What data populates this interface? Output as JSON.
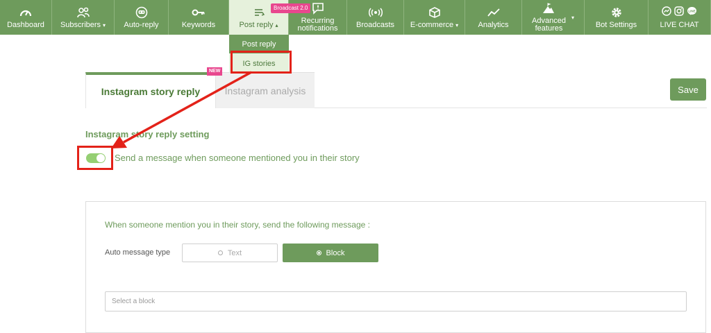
{
  "nav": {
    "items": [
      {
        "label": "Dashboard",
        "icon": "gauge-icon"
      },
      {
        "label": "Subscribers",
        "icon": "users-icon",
        "caret": "▾"
      },
      {
        "label": "Auto-reply",
        "icon": "robot-icon"
      },
      {
        "label": "Keywords",
        "icon": "key-icon"
      },
      {
        "label": "Post reply",
        "icon": "reply-icon",
        "caret": "▴",
        "active": true
      },
      {
        "label": "Recurring notifications",
        "icon": "message-alert-icon",
        "badge": "Broadcast 2.0"
      },
      {
        "label": "Broadcasts",
        "icon": "broadcast-icon"
      },
      {
        "label": "E-commerce",
        "icon": "box-icon",
        "caret": "▾"
      },
      {
        "label": "Analytics",
        "icon": "chart-line-icon"
      },
      {
        "label": "Advanced features",
        "icon": "mountain-flag-icon",
        "caret": "▾"
      },
      {
        "label": "Bot Settings",
        "icon": "gear-icon"
      },
      {
        "label": "LIVE CHAT",
        "icons": [
          "messenger-icon",
          "instagram-icon",
          "line-icon"
        ]
      }
    ],
    "dropdown": [
      "Post reply",
      "IG stories"
    ],
    "badge": "Broadcast 2.0",
    "recurring_line1": "Recurring",
    "recurring_line2": "notifications",
    "advanced_line1": "Advanced",
    "advanced_line2": "features"
  },
  "tabs": {
    "story": "Instagram story reply",
    "analysis": "Instagram analysis",
    "new_badge": "NEW"
  },
  "save_label": "Save",
  "settings": {
    "title": "Instagram story reply setting",
    "toggle_label": "Send a message when someone mentioned you in their story",
    "toggle_on": true
  },
  "panel": {
    "heading": "When someone mention you in their story, send the following message :",
    "type_label": "Auto message type",
    "type_options": [
      "Text",
      "Block"
    ],
    "selected_type": "Block",
    "select_placeholder": "Select a block"
  },
  "colors": {
    "nav_green": "#6e9b5c",
    "active_bg": "#e6f1dc",
    "badge_pink": "#e8478e",
    "annotation_red": "#e32219",
    "toggle_green": "#95cf73"
  }
}
